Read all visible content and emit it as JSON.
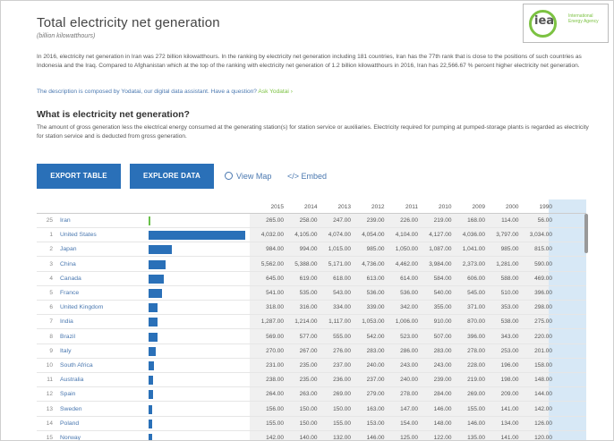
{
  "page": {
    "title": "Total electricity net generation",
    "subtitle": "(billion kilowatthours)"
  },
  "logo": {
    "text": "iea",
    "tagline": "International Energy Agency"
  },
  "description": {
    "paragraph": "In 2016, electricity net generation in Iran was 272 billion kilowatthours. In the ranking by electricity net generation including 181 countries, Iran has the 77th rank that is close to the positions of such countries as Indonesia and the Iraq. Compared to Afghanistan which at the top of the ranking with electricity net generation of 1.2 billion kilowatthours in 2016, Iran has 22,566.67 % percent higher electricity net generation.",
    "composed_by": "The description is composed by Yodatai, our digital data assistant. Have a question?",
    "ask_link": "Ask Yodatai ›"
  },
  "definition": {
    "heading": "What is electricity net generation?",
    "text": "The amount of gross generation less the electrical energy consumed at the generating station(s) for station service or auxiliaries. Electricity required for pumping at pumped-storage plants is regarded as electricity for station service and is deducted from gross generation."
  },
  "toolbar": {
    "export_label": "EXPORT TABLE",
    "explore_label": "EXPLORE DATA",
    "view_map_label": "View Map",
    "embed_label": "</> Embed"
  },
  "table": {
    "years": [
      "2015",
      "2014",
      "2013",
      "2012",
      "2011",
      "2010",
      "2009",
      "2000",
      "1990"
    ],
    "rows": [
      {
        "rank": "25",
        "country": "Iran",
        "share": 0.01,
        "values": [
          "265.00",
          "258.00",
          "247.00",
          "239.00",
          "226.00",
          "219.00",
          "168.00",
          "114.00",
          "56.00"
        ]
      },
      {
        "rank": "1",
        "country": "United States",
        "share": 1.0,
        "values": [
          "4,032.00",
          "4,105.00",
          "4,074.00",
          "4,054.00",
          "4,104.00",
          "4,127.00",
          "4,036.00",
          "3,797.00",
          "3,034.00"
        ]
      },
      {
        "rank": "2",
        "country": "Japan",
        "share": 0.24,
        "values": [
          "984.00",
          "994.00",
          "1,015.00",
          "985.00",
          "1,050.00",
          "1,087.00",
          "1,041.00",
          "985.00",
          "815.00"
        ]
      },
      {
        "rank": "3",
        "country": "China",
        "share": 0.18,
        "values": [
          "5,562.00",
          "5,388.00",
          "5,171.00",
          "4,736.00",
          "4,462.00",
          "3,984.00",
          "2,373.00",
          "1,281.00",
          "590.00"
        ]
      },
      {
        "rank": "4",
        "country": "Canada",
        "share": 0.16,
        "values": [
          "645.00",
          "619.00",
          "618.00",
          "613.00",
          "614.00",
          "584.00",
          "606.00",
          "588.00",
          "469.00"
        ]
      },
      {
        "rank": "5",
        "country": "France",
        "share": 0.14,
        "values": [
          "541.00",
          "535.00",
          "543.00",
          "536.00",
          "536.00",
          "540.00",
          "545.00",
          "510.00",
          "396.00"
        ]
      },
      {
        "rank": "6",
        "country": "United Kingdom",
        "share": 0.09,
        "values": [
          "318.00",
          "316.00",
          "334.00",
          "339.00",
          "342.00",
          "355.00",
          "371.00",
          "353.00",
          "298.00"
        ]
      },
      {
        "rank": "7",
        "country": "India",
        "share": 0.09,
        "values": [
          "1,287.00",
          "1,214.00",
          "1,117.00",
          "1,053.00",
          "1,006.00",
          "910.00",
          "870.00",
          "538.00",
          "275.00"
        ]
      },
      {
        "rank": "8",
        "country": "Brazil",
        "share": 0.09,
        "values": [
          "569.00",
          "577.00",
          "555.00",
          "542.00",
          "523.00",
          "507.00",
          "396.00",
          "343.00",
          "220.00"
        ]
      },
      {
        "rank": "9",
        "country": "Italy",
        "share": 0.07,
        "values": [
          "270.00",
          "267.00",
          "276.00",
          "283.00",
          "286.00",
          "283.00",
          "278.00",
          "253.00",
          "201.00"
        ]
      },
      {
        "rank": "10",
        "country": "South Africa",
        "share": 0.06,
        "values": [
          "231.00",
          "235.00",
          "237.00",
          "240.00",
          "243.00",
          "243.00",
          "228.00",
          "196.00",
          "158.00"
        ]
      },
      {
        "rank": "11",
        "country": "Australia",
        "share": 0.05,
        "values": [
          "238.00",
          "235.00",
          "236.00",
          "237.00",
          "240.00",
          "239.00",
          "219.00",
          "198.00",
          "148.00"
        ]
      },
      {
        "rank": "12",
        "country": "Spain",
        "share": 0.05,
        "values": [
          "264.00",
          "263.00",
          "269.00",
          "279.00",
          "278.00",
          "284.00",
          "269.00",
          "209.00",
          "144.00"
        ]
      },
      {
        "rank": "13",
        "country": "Sweden",
        "share": 0.04,
        "values": [
          "156.00",
          "150.00",
          "150.00",
          "163.00",
          "147.00",
          "146.00",
          "155.00",
          "141.00",
          "142.00"
        ]
      },
      {
        "rank": "14",
        "country": "Poland",
        "share": 0.04,
        "values": [
          "155.00",
          "150.00",
          "155.00",
          "153.00",
          "154.00",
          "148.00",
          "146.00",
          "134.00",
          "126.00"
        ]
      },
      {
        "rank": "15",
        "country": "Norway",
        "share": 0.04,
        "values": [
          "142.00",
          "140.00",
          "132.00",
          "146.00",
          "125.00",
          "122.00",
          "135.00",
          "141.00",
          "120.00"
        ]
      }
    ]
  }
}
